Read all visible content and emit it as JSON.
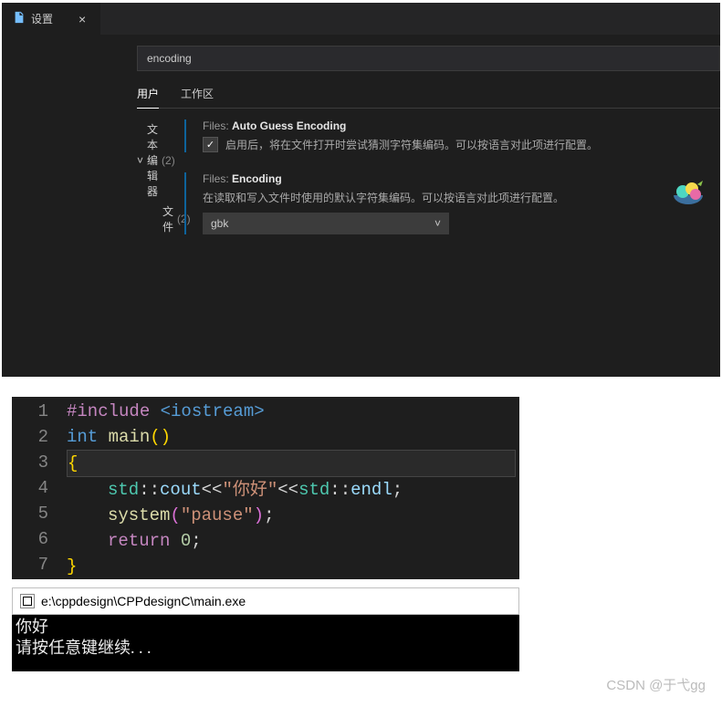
{
  "tab": {
    "title": "设置",
    "close": "×"
  },
  "search": {
    "value": "encoding"
  },
  "scope": {
    "user": "用户",
    "workspace": "工作区"
  },
  "tree": {
    "text_editor": "文本编辑器",
    "text_editor_count": "(2)",
    "files": "文件",
    "files_count": "(2)"
  },
  "settings": {
    "autoGuess": {
      "prefix": "Files: ",
      "name": "Auto Guess Encoding",
      "desc": "启用后，将在文件打开时尝试猜测字符集编码。可以按语言对此项进行配置。",
      "checked": "✓"
    },
    "encoding": {
      "prefix": "Files: ",
      "name": "Encoding",
      "desc": "在读取和写入文件时使用的默认字符集编码。可以按语言对此项进行配置。",
      "value": "gbk"
    }
  },
  "code": {
    "lines": [
      "1",
      "2",
      "3",
      "4",
      "5",
      "6",
      "7"
    ],
    "l1_pp": "#include",
    "l1_inc": " <iostream>",
    "l2_kw": "int",
    "l2_fn": " main",
    "l4_ns": "std",
    "l4_var": "cout",
    "l4_str": "\"你好\"",
    "l4_endl": "endl",
    "l5_fn": "system",
    "l5_str": "\"pause\"",
    "l6_kw": "return",
    "l6_num": " 0"
  },
  "terminal": {
    "title": "e:\\cppdesign\\CPPdesignC\\main.exe",
    "line1": "你好",
    "line2": "请按任意键继续. . ."
  },
  "watermark": "CSDN @于弋gg"
}
